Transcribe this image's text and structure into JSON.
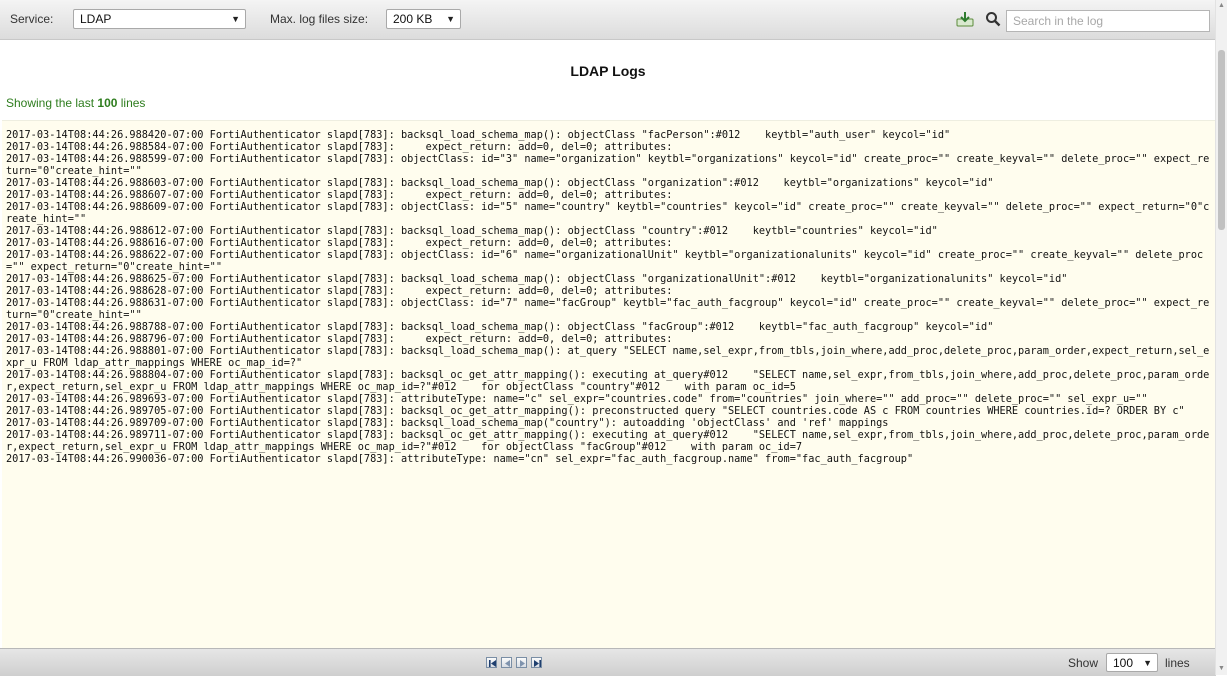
{
  "toolbar": {
    "service_label": "Service:",
    "service_value": "LDAP",
    "max_size_label": "Max. log files size:",
    "max_size_value": "200 KB",
    "search_placeholder": "Search in the log",
    "download_icon": "download-icon",
    "search_icon": "magnifier-icon"
  },
  "main": {
    "title": "LDAP Logs",
    "showing_prefix": "Showing the last ",
    "showing_count": "100",
    "showing_suffix": " lines"
  },
  "log_lines": [
    "2017-03-14T08:44:26.988420-07:00 FortiAuthenticator slapd[783]: backsql_load_schema_map(): objectClass \"facPerson\":#012    keytbl=\"auth_user\" keycol=\"id\"",
    "2017-03-14T08:44:26.988584-07:00 FortiAuthenticator slapd[783]:     expect_return: add=0, del=0; attributes:",
    "2017-03-14T08:44:26.988599-07:00 FortiAuthenticator slapd[783]: objectClass: id=\"3\" name=\"organization\" keytbl=\"organizations\" keycol=\"id\" create_proc=\"\" create_keyval=\"\" delete_proc=\"\" expect_return=\"0\"create_hint=\"\"",
    "2017-03-14T08:44:26.988603-07:00 FortiAuthenticator slapd[783]: backsql_load_schema_map(): objectClass \"organization\":#012    keytbl=\"organizations\" keycol=\"id\"",
    "2017-03-14T08:44:26.988607-07:00 FortiAuthenticator slapd[783]:     expect_return: add=0, del=0; attributes:",
    "2017-03-14T08:44:26.988609-07:00 FortiAuthenticator slapd[783]: objectClass: id=\"5\" name=\"country\" keytbl=\"countries\" keycol=\"id\" create_proc=\"\" create_keyval=\"\" delete_proc=\"\" expect_return=\"0\"create_hint=\"\"",
    "2017-03-14T08:44:26.988612-07:00 FortiAuthenticator slapd[783]: backsql_load_schema_map(): objectClass \"country\":#012    keytbl=\"countries\" keycol=\"id\"",
    "2017-03-14T08:44:26.988616-07:00 FortiAuthenticator slapd[783]:     expect_return: add=0, del=0; attributes:",
    "2017-03-14T08:44:26.988622-07:00 FortiAuthenticator slapd[783]: objectClass: id=\"6\" name=\"organizationalUnit\" keytbl=\"organizationalunits\" keycol=\"id\" create_proc=\"\" create_keyval=\"\" delete_proc=\"\" expect_return=\"0\"create_hint=\"\"",
    "2017-03-14T08:44:26.988625-07:00 FortiAuthenticator slapd[783]: backsql_load_schema_map(): objectClass \"organizationalUnit\":#012    keytbl=\"organizationalunits\" keycol=\"id\"",
    "2017-03-14T08:44:26.988628-07:00 FortiAuthenticator slapd[783]:     expect_return: add=0, del=0; attributes:",
    "2017-03-14T08:44:26.988631-07:00 FortiAuthenticator slapd[783]: objectClass: id=\"7\" name=\"facGroup\" keytbl=\"fac_auth_facgroup\" keycol=\"id\" create_proc=\"\" create_keyval=\"\" delete_proc=\"\" expect_return=\"0\"create_hint=\"\"",
    "2017-03-14T08:44:26.988788-07:00 FortiAuthenticator slapd[783]: backsql_load_schema_map(): objectClass \"facGroup\":#012    keytbl=\"fac_auth_facgroup\" keycol=\"id\"",
    "2017-03-14T08:44:26.988796-07:00 FortiAuthenticator slapd[783]:     expect_return: add=0, del=0; attributes:",
    "2017-03-14T08:44:26.988801-07:00 FortiAuthenticator slapd[783]: backsql_load_schema_map(): at_query \"SELECT name,sel_expr,from_tbls,join_where,add_proc,delete_proc,param_order,expect_return,sel_expr_u FROM ldap_attr_mappings WHERE oc_map_id=?\"",
    "2017-03-14T08:44:26.988804-07:00 FortiAuthenticator slapd[783]: backsql_oc_get_attr_mapping(): executing at_query#012    \"SELECT name,sel_expr,from_tbls,join_where,add_proc,delete_proc,param_order,expect_return,sel_expr_u FROM ldap_attr_mappings WHERE oc_map_id=?\"#012    for objectClass \"country\"#012    with param oc_id=5",
    "2017-03-14T08:44:26.989693-07:00 FortiAuthenticator slapd[783]: attributeType: name=\"c\" sel_expr=\"countries.code\" from=\"countries\" join_where=\"\" add_proc=\"\" delete_proc=\"\" sel_expr_u=\"\"",
    "2017-03-14T08:44:26.989705-07:00 FortiAuthenticator slapd[783]: backsql_oc_get_attr_mapping(): preconstructed query \"SELECT countries.code AS c FROM countries WHERE countries.id=? ORDER BY c\"",
    "2017-03-14T08:44:26.989709-07:00 FortiAuthenticator slapd[783]: backsql_load_schema_map(\"country\"): autoadding 'objectClass' and 'ref' mappings",
    "2017-03-14T08:44:26.989711-07:00 FortiAuthenticator slapd[783]: backsql_oc_get_attr_mapping(): executing at_query#012    \"SELECT name,sel_expr,from_tbls,join_where,add_proc,delete_proc,param_order,expect_return,sel_expr_u FROM ldap_attr_mappings WHERE oc_map_id=?\"#012    for objectClass \"facGroup\"#012    with param oc_id=7",
    "2017-03-14T08:44:26.990036-07:00 FortiAuthenticator slapd[783]: attributeType: name=\"cn\" sel_expr=\"fac_auth_facgroup.name\" from=\"fac_auth_facgroup\""
  ],
  "footer": {
    "show_label": "Show",
    "show_value": "100",
    "lines_label": "lines"
  }
}
